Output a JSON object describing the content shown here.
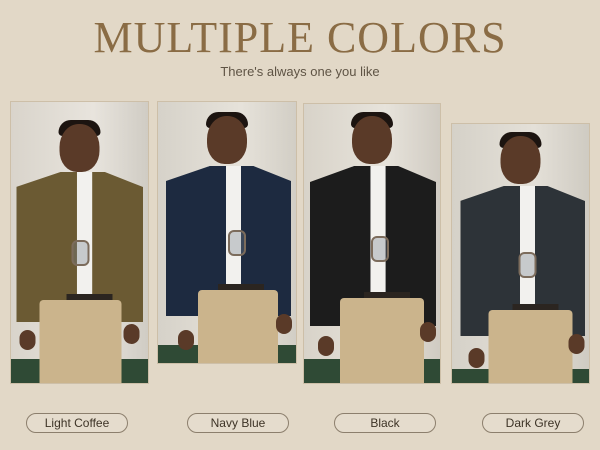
{
  "header": {
    "title": "MULTIPLE COLORS",
    "subtitle": "There's always one you like"
  },
  "colors": [
    {
      "name": "Light Coffee",
      "jacket": "#6b5a33"
    },
    {
      "name": "Navy Blue",
      "jacket": "#1d2a40"
    },
    {
      "name": "Black",
      "jacket": "#1c1c1c"
    },
    {
      "name": "Dark Grey",
      "jacket": "#2d3338"
    }
  ]
}
